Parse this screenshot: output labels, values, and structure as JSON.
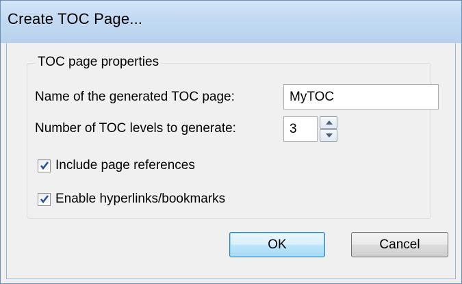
{
  "dialog": {
    "title": "Create TOC Page..."
  },
  "group": {
    "legend": "TOC page properties"
  },
  "fields": {
    "name_label": "Name of the generated TOC page:",
    "name_value": "MyTOC",
    "levels_label": "Number of TOC levels to generate:",
    "levels_value": "3"
  },
  "options": {
    "include_page_refs": {
      "label": "Include page references",
      "checked": true
    },
    "enable_hyperlinks": {
      "label": "Enable hyperlinks/bookmarks",
      "checked": true
    }
  },
  "buttons": {
    "ok_label": "OK",
    "cancel_label": "Cancel"
  },
  "colors": {
    "titlebar": "#c2d9f2",
    "default_button_border": "#3c7fb1",
    "checkmark": "#2a4f8f"
  },
  "icons": {
    "spin_up": "triangle-up",
    "spin_down": "triangle-down",
    "check": "checkmark"
  }
}
